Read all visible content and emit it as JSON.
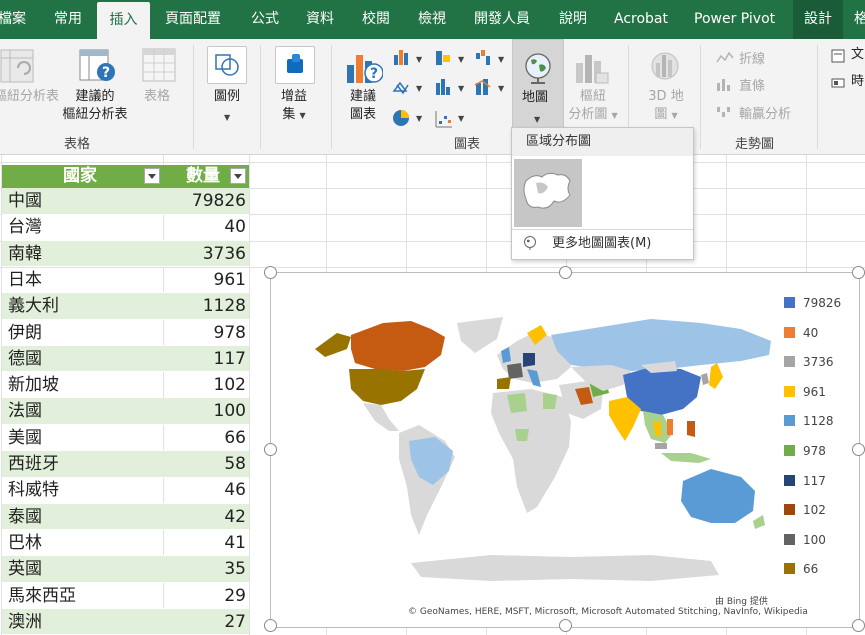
{
  "tabs": [
    "檔案",
    "常用",
    "插入",
    "頁面配置",
    "公式",
    "資料",
    "校閱",
    "檢視",
    "開發人員",
    "說明",
    "Acrobat",
    "Power Pivot",
    "設計",
    "格"
  ],
  "ribbon": {
    "pivot_label": "樞紐分析表",
    "rec_pivot_label_1": "建議的",
    "rec_pivot_label_2": "樞紐分析表",
    "table_label": "表格",
    "group_tables": "表格",
    "illus_label": "圖例",
    "addins_label_1": "增益",
    "addins_label_2": "集",
    "rec_charts_label_1": "建議",
    "rec_charts_label_2": "圖表",
    "group_charts": "圖表",
    "map_label": "地圖",
    "pivotchart_label_1": "樞紐",
    "pivotchart_label_2": "分析圖",
    "map3d_label_1": "3D 地",
    "map3d_label_2": "圖",
    "spark_line": "折線",
    "spark_column": "直條",
    "spark_winloss": "輸贏分析",
    "group_sparklines": "走勢圖",
    "right_1": "文",
    "right_2": "時"
  },
  "dropdown": {
    "header": "區域分布圖",
    "more": "更多地圖圖表(M)"
  },
  "table": {
    "header_country": "國家",
    "header_qty": "數量",
    "rows": [
      {
        "country": "中國",
        "qty": "79826"
      },
      {
        "country": "台灣",
        "qty": "40"
      },
      {
        "country": "南韓",
        "qty": "3736"
      },
      {
        "country": "日本",
        "qty": "961"
      },
      {
        "country": "義大利",
        "qty": "1128"
      },
      {
        "country": "伊朗",
        "qty": "978"
      },
      {
        "country": "德國",
        "qty": "117"
      },
      {
        "country": "新加坡",
        "qty": "102"
      },
      {
        "country": "法國",
        "qty": "100"
      },
      {
        "country": "美國",
        "qty": "66"
      },
      {
        "country": "西班牙",
        "qty": "58"
      },
      {
        "country": "科威特",
        "qty": "46"
      },
      {
        "country": "泰國",
        "qty": "42"
      },
      {
        "country": "巴林",
        "qty": "41"
      },
      {
        "country": "英國",
        "qty": "35"
      },
      {
        "country": "馬來西亞",
        "qty": "29"
      },
      {
        "country": "澳洲",
        "qty": "27"
      }
    ]
  },
  "chart": {
    "legend": [
      {
        "label": "79826",
        "color": "#4472c4"
      },
      {
        "label": "40",
        "color": "#ed7d31"
      },
      {
        "label": "3736",
        "color": "#a5a5a5"
      },
      {
        "label": "961",
        "color": "#ffc000"
      },
      {
        "label": "1128",
        "color": "#5b9bd5"
      },
      {
        "label": "978",
        "color": "#70ad47"
      },
      {
        "label": "117",
        "color": "#264478"
      },
      {
        "label": "102",
        "color": "#9e480e"
      },
      {
        "label": "100",
        "color": "#636363"
      },
      {
        "label": "66",
        "color": "#997300"
      }
    ],
    "credit_1": "由 Bing 提供",
    "credit_2": "© GeoNames, HERE, MSFT, Microsoft, Microsoft Automated Stitching, NavInfo, Wikipedia"
  },
  "colors": {
    "excel_green": "#217346",
    "table_header": "#70ad47",
    "band": "#e2efda"
  }
}
